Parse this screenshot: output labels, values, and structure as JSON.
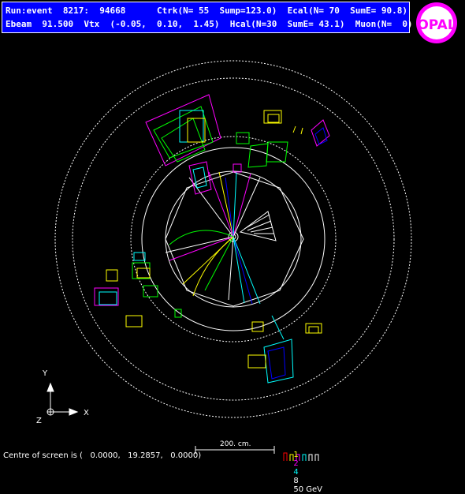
{
  "header": {
    "line1": "Run:event  8217:  94668      Ctrk(N= 55  Sump=123.0)  Ecal(N= 70  SumE= 90.8)",
    "line2": "Ebeam  91.500  Vtx  (-0.05,  0.10,  1.45)  Hcal(N=30  SumE= 43.1)  Muon(N=  0)"
  },
  "logo": {
    "text": "OPAL",
    "colors": {
      "ring": "#ff00ff",
      "fill": "#ffffff"
    }
  },
  "axes": {
    "y": "Y",
    "x": "X",
    "z": "Z"
  },
  "scale": {
    "label": "200. cm."
  },
  "energy_scale": {
    "values": [
      "1",
      "2",
      "4",
      "8",
      "50 GeV"
    ],
    "colors": [
      "#ffff00",
      "#ff00ff",
      "#00ffff",
      "#ffffff",
      "#ffffff"
    ]
  },
  "footer": {
    "centre": "Centre of screen is (   0.0000,   19.2857,   0.0000)"
  },
  "colors": {
    "background": "#000000",
    "header_bg": "#0000ff"
  }
}
